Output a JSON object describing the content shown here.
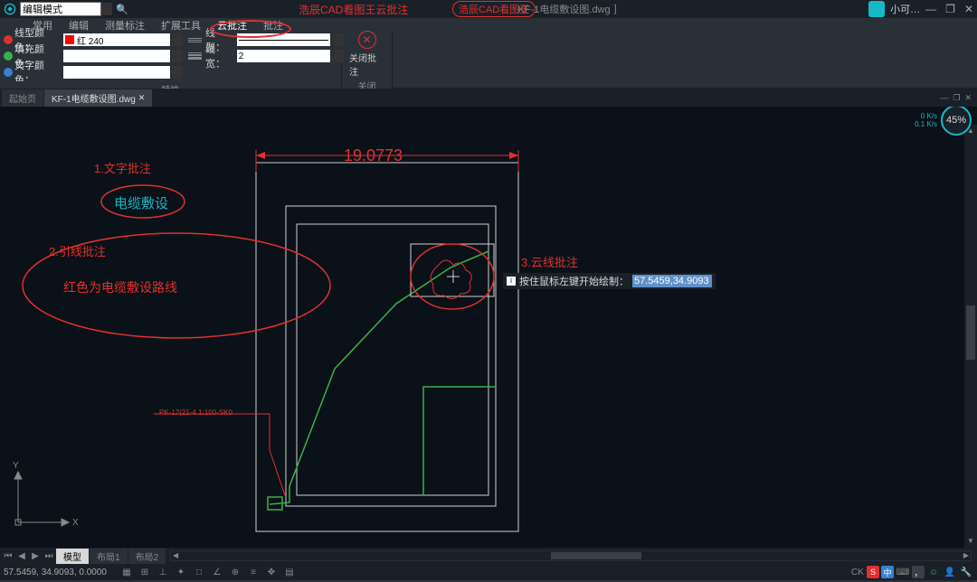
{
  "title": {
    "app_name": "浩辰CAD看图王",
    "file_name": "KF-1电缆敷设图.dwg",
    "mode_label": "编辑模式",
    "user_label": "小可…",
    "red_callout_top": "浩辰CAD看图王云批注"
  },
  "mainmenu": {
    "items": [
      "常用",
      "编辑",
      "测量标注",
      "扩展工具",
      "云批注",
      "批注"
    ],
    "circled": [
      "云批注",
      "批注"
    ]
  },
  "ribbon": {
    "group_props": {
      "title": "特性",
      "line_color_label": "线型颜色：",
      "line_color_value": "红 240",
      "fill_color_label": "填充颜色：",
      "text_color_label": "文字颜色：",
      "linetype_label": "线型：",
      "linetype_value": "",
      "lineweight_label": "线宽：",
      "lineweight_value": "2"
    },
    "group_close": {
      "title": "关闭",
      "btn_label": "关闭批注"
    }
  },
  "doctabs": {
    "start_tab": "起始页",
    "active_tab": "KF-1电缆敷设图.dwg"
  },
  "perf": {
    "pct": "45%",
    "l1": "0 K/s",
    "l2": "0.1 K/s"
  },
  "canvas": {
    "dim_text": "19.0773",
    "annot1_num": "1.文字批注",
    "annot1_text": "电缆敷设",
    "annot2_num": "2.引线批注",
    "annot2_text": "红色为电缆敷设路线",
    "annot3_num": "3.云线批注",
    "tooltip_label": "按住鼠标左键开始绘制：",
    "tooltip_value": "57.5459,34.9093",
    "small_red_label": "PK-17(21-4 1:100-SK0"
  },
  "bottom_tabs": {
    "t1": "模型",
    "t2": "布局1",
    "t3": "布局2"
  },
  "status": {
    "coords": "57.5459, 34.9093, 0.0000"
  },
  "status_right": {
    "ck": "CK"
  }
}
